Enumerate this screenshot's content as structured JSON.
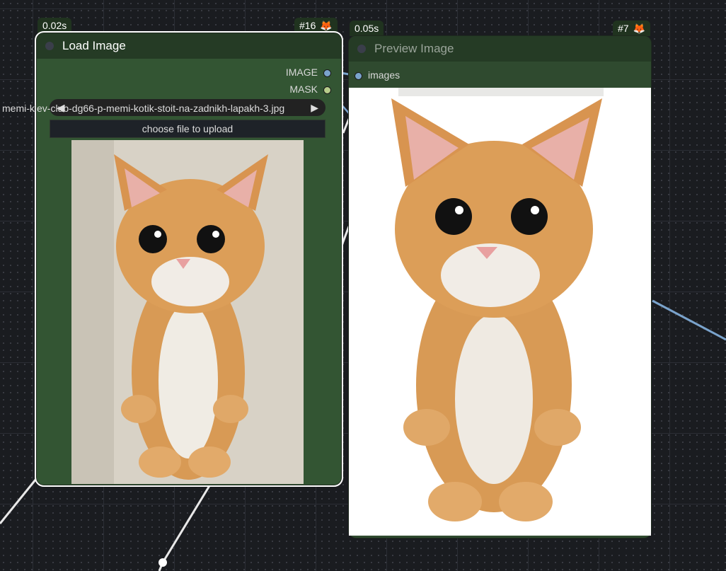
{
  "nodes": {
    "load_image": {
      "time": "0.02s",
      "id": "#16",
      "title": "Load Image",
      "outputs": [
        {
          "label": "IMAGE",
          "color": "#7aa3cc"
        },
        {
          "label": "MASK",
          "color": "#8fc48f"
        }
      ],
      "image_widget": {
        "value": "memi-klev-club-dg66-p-memi-kotik-stoit-na-zadnikh-lapakh-3.jpg",
        "value_overflow": "memi-klev-club-dg66-p-memi-kotik-stoit-na-zadnikh-lapakh-3.jpg"
      },
      "upload_label": "choose file to upload"
    },
    "preview_image": {
      "time": "0.05s",
      "id": "#7",
      "title": "Preview Image",
      "inputs": [
        {
          "label": "images",
          "color": "#7aa3cc"
        }
      ]
    }
  },
  "icons": {
    "badge": "fox-icon"
  },
  "colors": {
    "node_body": "#335533",
    "node_title": "#253b25",
    "canvas": "#1a1c20",
    "link_image": "#7aa3cc",
    "link_white": "#ffffff"
  }
}
